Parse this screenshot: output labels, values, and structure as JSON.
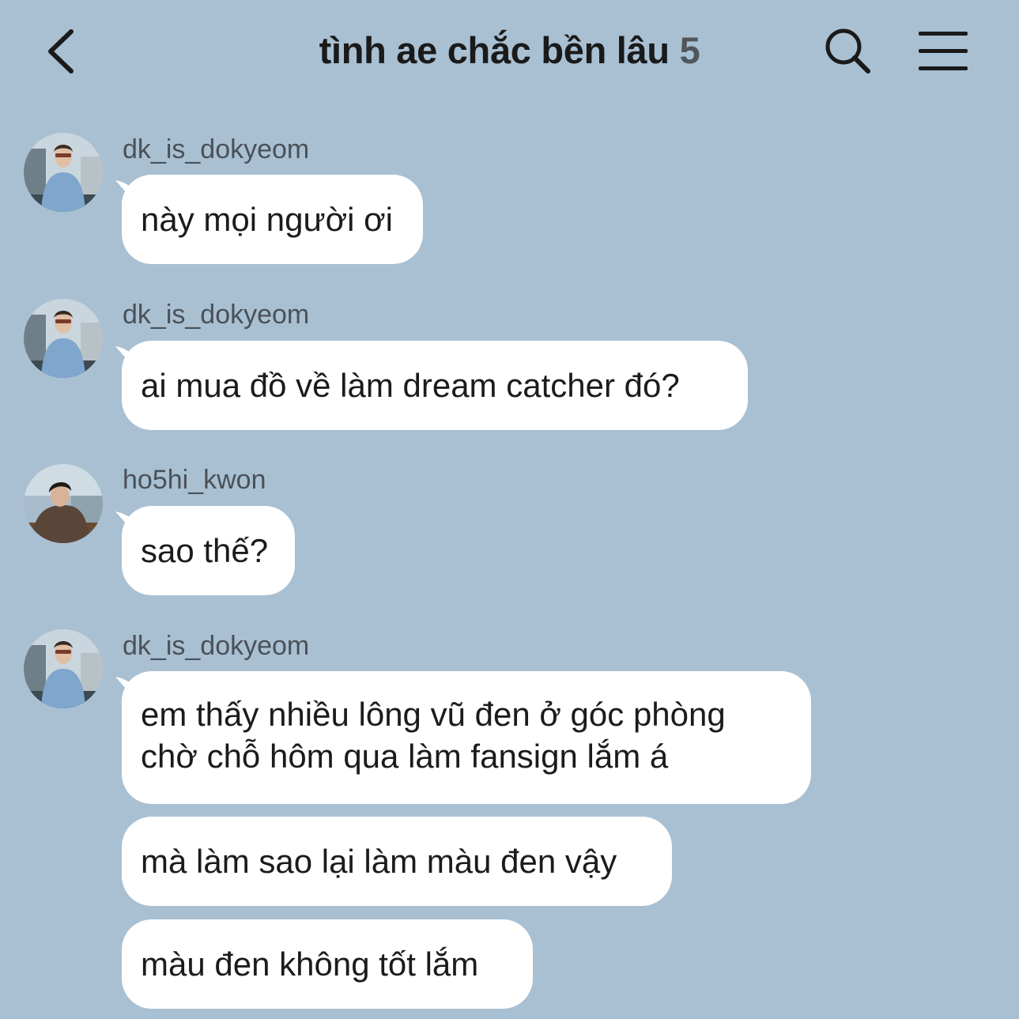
{
  "header": {
    "title": "tình ae chắc bền lâu",
    "member_count": "5",
    "back_icon": "chevron-left-icon",
    "search_icon": "search-icon",
    "menu_icon": "hamburger-menu-icon"
  },
  "colors": {
    "background": "#a9c0d3",
    "bubble": "#ffffff",
    "sender_text": "#4a5158",
    "title_text": "#1a1a1a"
  },
  "messages": [
    {
      "sender": "dk_is_dokyeom",
      "lines": [
        "này mọi người ơi"
      ]
    },
    {
      "sender": "dk_is_dokyeom",
      "lines": [
        "ai mua đồ về làm dream catcher đó?"
      ]
    },
    {
      "sender": "ho5hi_kwon",
      "lines": [
        "sao thế?"
      ]
    },
    {
      "sender": "dk_is_dokyeom",
      "lines": [
        "em thấy nhiều lông vũ đen ở góc phòng",
        "chờ chỗ hôm qua làm fansign lắm á"
      ]
    },
    {
      "sender": "dk_is_dokyeom",
      "lines": [
        "mà làm sao lại làm màu đen vậy"
      ]
    },
    {
      "sender": "dk_is_dokyeom",
      "lines": [
        "màu đen không tốt lắm"
      ]
    }
  ]
}
